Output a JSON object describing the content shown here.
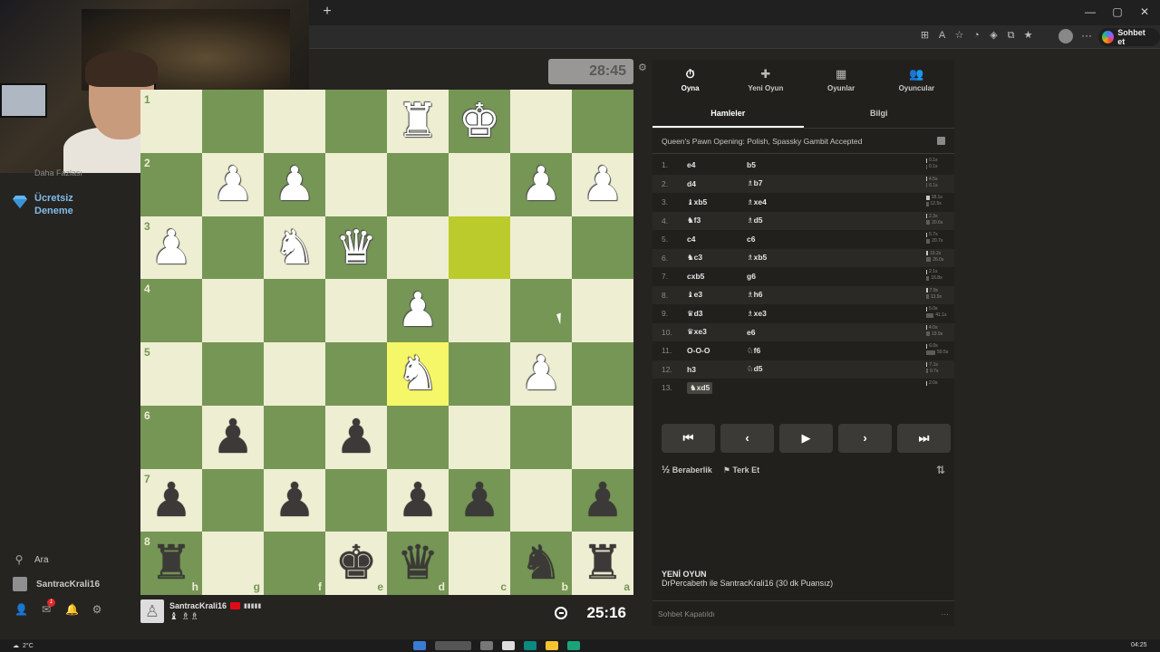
{
  "browser": {
    "new_tab": "+",
    "window_controls": [
      "—",
      "▢",
      "✕"
    ],
    "menu": "···",
    "copilot_label": "Sohbet et"
  },
  "sidebar": {
    "faded_label": "Daha Fazlası",
    "trial_label_line1": "Ücretsiz",
    "trial_label_line2": "Deneme",
    "search_label": "Ara",
    "user_label": "SantracKrali16",
    "notification_count": "1"
  },
  "board": {
    "ranks": [
      "1",
      "2",
      "3",
      "4",
      "5",
      "6",
      "7",
      "8"
    ],
    "files": [
      "h",
      "g",
      "f",
      "e",
      "d",
      "c",
      "b",
      "a"
    ],
    "squares": [
      [
        "",
        "",
        "",
        "",
        "wR",
        "wK",
        "",
        ""
      ],
      [
        "",
        "wP",
        "wP",
        "",
        "",
        "",
        "wP",
        "wP"
      ],
      [
        "wP",
        "",
        "wN",
        "wQ",
        "",
        "",
        "",
        ""
      ],
      [
        "",
        "",
        "",
        "",
        "wP",
        "",
        "",
        ""
      ],
      [
        "",
        "",
        "",
        "",
        "wN",
        "",
        "wP",
        ""
      ],
      [
        "",
        "bP",
        "",
        "bP",
        "",
        "",
        "",
        ""
      ],
      [
        "bP",
        "",
        "bP",
        "",
        "bP",
        "bP",
        "",
        "bP"
      ],
      [
        "bR",
        "",
        "",
        "bK",
        "bQ",
        "",
        "bN",
        "bR"
      ]
    ],
    "highlight": [
      [
        2,
        5
      ],
      [
        4,
        4
      ]
    ]
  },
  "clocks": {
    "opponent": "28:45",
    "player": "25:16"
  },
  "player": {
    "name": "SantracKrali16",
    "captured": "♝ ♗♗"
  },
  "panel": {
    "top_tabs": [
      {
        "label": "Oyna",
        "icon": "stopwatch-icon",
        "glyph": "⏱"
      },
      {
        "label": "Yeni Oyun",
        "icon": "plus-icon",
        "glyph": "✚"
      },
      {
        "label": "Oyunlar",
        "icon": "board-icon",
        "glyph": "▦"
      },
      {
        "label": "Oyuncular",
        "icon": "players-icon",
        "glyph": "👥"
      }
    ],
    "sub_tabs": [
      "Hamleler",
      "Bilgi"
    ],
    "opening": "Queen's Pawn Opening: Polish, Spassky Gambit Accepted",
    "moves": [
      {
        "n": "1.",
        "w": "e4",
        "b": "b5",
        "tw": "0.1s",
        "tb": "0.1s"
      },
      {
        "n": "2.",
        "w": "d4",
        "b": "♗b7",
        "tw": "4.5s",
        "tb": "6.1s"
      },
      {
        "n": "3.",
        "w": "♝xb5",
        "b": "♗xe4",
        "tw": "18.1s",
        "tb": "12.5s"
      },
      {
        "n": "4.",
        "w": "♞f3",
        "b": "♗d5",
        "tw": "2.3s",
        "tb": "20.6s"
      },
      {
        "n": "5.",
        "w": "c4",
        "b": "c6",
        "tw": "5.7s",
        "tb": "20.7s"
      },
      {
        "n": "6.",
        "w": "♞c3",
        "b": "♗xb5",
        "tw": "10.2s",
        "tb": "26.0s"
      },
      {
        "n": "7.",
        "w": "cxb5",
        "b": "g6",
        "tw": "2.1s",
        "tb": "16.8s"
      },
      {
        "n": "8.",
        "w": "♝e3",
        "b": "♗h6",
        "tw": "7.9s",
        "tb": "13.9s"
      },
      {
        "n": "9.",
        "w": "♛d3",
        "b": "♗xe3",
        "tw": "5.0s",
        "tb": "41.1s"
      },
      {
        "n": "10.",
        "w": "♛xe3",
        "b": "e6",
        "tw": "4.0s",
        "tb": "19.9s"
      },
      {
        "n": "11.",
        "w": "O-O-O",
        "b": "♘f6",
        "tw": "6.0s",
        "tb": "50.5s"
      },
      {
        "n": "12.",
        "w": "h3",
        "b": "♘d5",
        "tw": "7.1s",
        "tb": "9.7s"
      },
      {
        "n": "13.",
        "w": "♞xd5",
        "b": "",
        "tw": "2.0s",
        "tb": ""
      }
    ],
    "nav_buttons": [
      "⏮",
      "‹",
      "▶",
      "›",
      "⏭"
    ],
    "draw_label": "Beraberlik",
    "draw_icon": "½",
    "resign_label": "Terk Et",
    "new_game_title": "YENİ OYUN",
    "new_game_desc": "DrPercabeth ile SantracKrali16 (30 dk Puansız)",
    "chat_label": "Sohbet Kapatıldı",
    "chat_more": "···"
  },
  "taskbar": {
    "temp": "2°C",
    "time": "04:25"
  }
}
